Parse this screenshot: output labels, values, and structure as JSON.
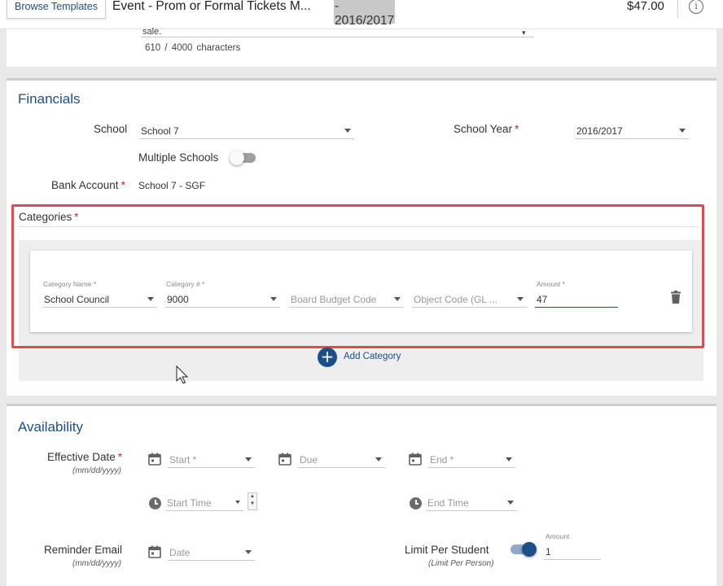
{
  "topbar": {
    "browse_label": "Browse Templates",
    "title": "Event - Prom or Formal Tickets M...",
    "year": "- 2016/2017",
    "price": "$47.00",
    "info_icon": "i"
  },
  "description": {
    "text_tail": "sale.",
    "char_count": "610 / 4000 characters"
  },
  "financials": {
    "title": "Financials",
    "school_label": "School",
    "school_value": "School 7",
    "school_year_label": "School Year",
    "school_year_value": "2016/2017",
    "multiple_schools_label": "Multiple Schools",
    "multiple_schools_on": false,
    "bank_account_label": "Bank Account",
    "bank_account_value": "School 7 - SGF",
    "required_mark": "*"
  },
  "categories": {
    "title": "Categories",
    "row": {
      "name_label": "Category Name *",
      "name_value": "School Council",
      "number_label": "Category # *",
      "number_value": "9000",
      "board_budget_placeholder": "Board Budget Code",
      "object_code_placeholder": "Object Code (GL ...",
      "amount_label": "Amount *",
      "amount_value": "47"
    },
    "add_label": "Add Category",
    "add_symbol": "+"
  },
  "availability": {
    "title": "Availability",
    "effective_date_label": "Effective Date",
    "date_format": "(mm/dd/yyyy)",
    "start_placeholder": "Start *",
    "due_placeholder": "Due",
    "end_placeholder": "End *",
    "start_time_placeholder": "Start Time",
    "end_time_placeholder": "End Time",
    "reminder_label": "Reminder Email",
    "reminder_placeholder": "Date",
    "limit_label": "Limit Per Student",
    "limit_sub": "(Limit Per Person)",
    "limit_on": true,
    "limit_amount_label": "Amount",
    "limit_amount_value": "1",
    "spinner_up": "▲",
    "spinner_down": "▼"
  },
  "colors": {
    "accent": "#1b4f8a",
    "highlight": "#e5484d",
    "required": "#c62828"
  }
}
